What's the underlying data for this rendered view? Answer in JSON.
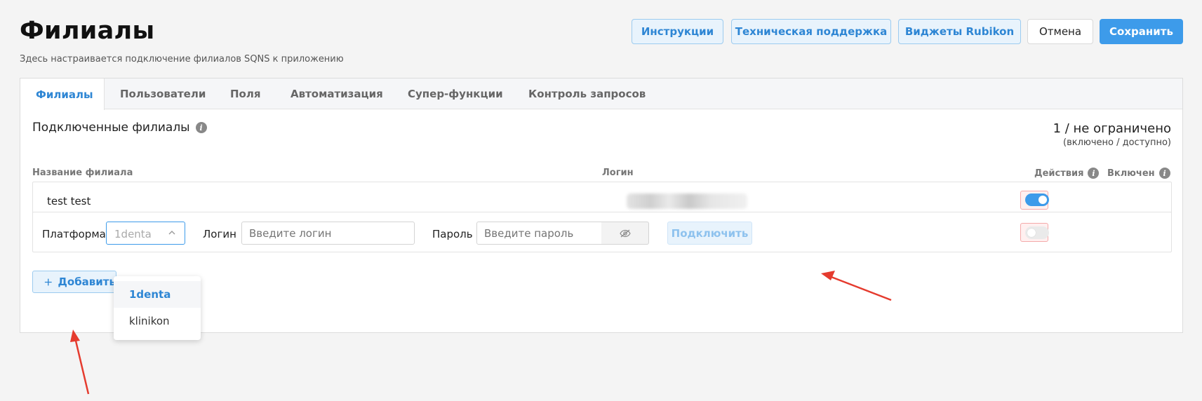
{
  "header": {
    "title": "Филиалы",
    "subtitle": "Здесь настраивается подключение филиалов SQNS к приложению",
    "buttons": {
      "instructions": "Инструкции",
      "support": "Техническая поддержка",
      "widgets": "Виджеты Rubikon",
      "cancel": "Отмена",
      "save": "Сохранить"
    }
  },
  "tabs": [
    "Филиалы",
    "Пользователи",
    "Поля",
    "Автоматизация",
    "Супер-функции",
    "Контроль запросов"
  ],
  "section": {
    "title": "Подключенные филиалы",
    "count": "1 / не ограничено",
    "count_caption": "(включено / доступно)"
  },
  "columns": {
    "name": "Название филиала",
    "login": "Логин",
    "actions": "Действия",
    "enabled": "Включен"
  },
  "branches": [
    {
      "name": "test test",
      "login_hidden": true,
      "enabled": true
    }
  ],
  "new_branch": {
    "platform_label": "Платформа",
    "platform_value": "1denta",
    "login_label": "Логин",
    "login_placeholder": "Введите логин",
    "password_label": "Пароль",
    "password_placeholder": "Введите пароль",
    "connect_label": "Подключить",
    "enabled": false
  },
  "platform_options": [
    "1denta",
    "klinikon"
  ],
  "add_button": "Добавить",
  "colors": {
    "accent": "#3d9bea",
    "delete": "#e05b5b",
    "annotation_arrow": "#e53b2e"
  }
}
